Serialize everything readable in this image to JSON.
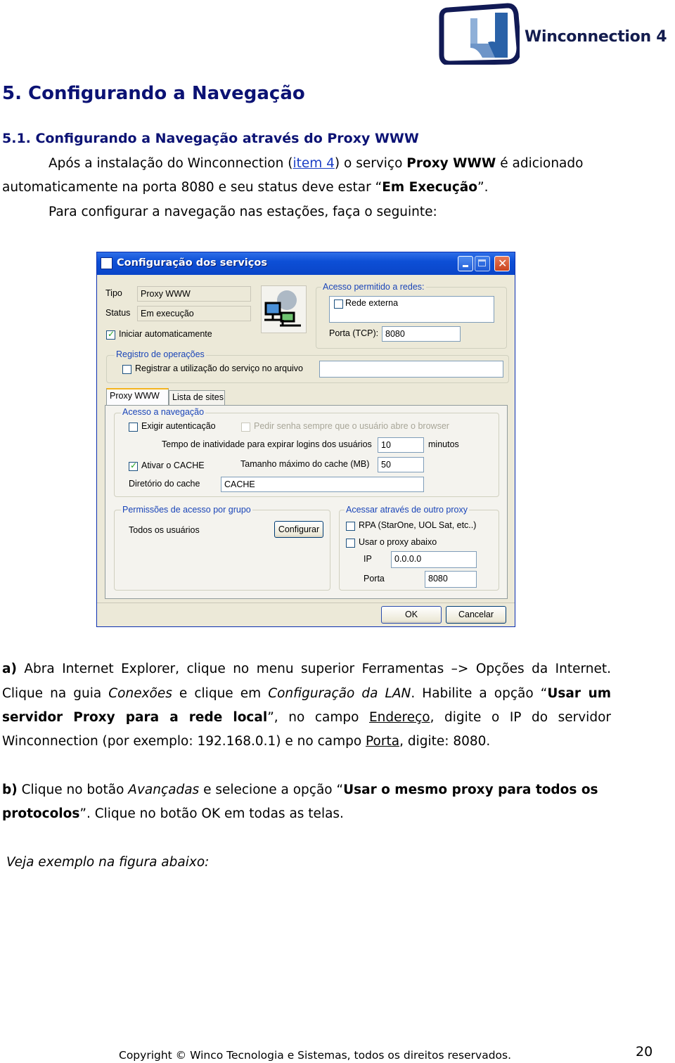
{
  "logo": {
    "text": "Winconnection 4",
    "icon": "winconnection-logo-icon"
  },
  "heading": "5. Configurando a Navegação",
  "subheading": "5.1. Configurando a Navegação através do Proxy WWW",
  "intro": {
    "line1_a": "Após a instalação do Winconnection (",
    "line1_link": "item 4",
    "line1_b": ") o serviço ",
    "line1_bold": "Proxy WWW",
    "line1_c": " é adicionado",
    "line2_a": "automaticamente na porta 8080 e seu status deve estar “",
    "line2_bold": "Em Execução",
    "line2_b": "”.",
    "line3": "Para configurar a navegação nas estações, faça o seguinte:"
  },
  "dialog": {
    "title": "Configuração dos serviços",
    "tipo_label": "Tipo",
    "tipo_value": "Proxy WWW",
    "status_label": "Status",
    "status_value": "Em execução",
    "auto_start_label": "Iniciar automaticamente",
    "auto_start_checked": true,
    "access_group_label": "Acesso permitido a redes:",
    "external_net_label": "Rede externa",
    "external_net_checked": false,
    "port_label": "Porta (TCP):",
    "port_value": "8080",
    "log_group_label": "Registro de operações",
    "log_checkbox_label": "Registrar a utilização do serviço no arquivo",
    "log_checked": false,
    "log_file_value": "",
    "tabs": [
      {
        "label": "Proxy WWW",
        "active": true
      },
      {
        "label": "Lista de sites",
        "active": false
      }
    ],
    "nav_group_label": "Acesso a navegação",
    "require_auth_label": "Exigir autenticação",
    "require_auth_checked": false,
    "ask_password_label": "Pedir senha sempre que o usuário abre o browser",
    "ask_password_checked": false,
    "idle_label": "Tempo de inatividade para expirar logins dos usuários",
    "idle_value": "10",
    "idle_unit": "minutos",
    "cache_enable_label": "Ativar o CACHE",
    "cache_enable_checked": true,
    "cache_size_label": "Tamanho máximo do cache (MB)",
    "cache_size_value": "50",
    "cache_dir_label": "Diretório do cache",
    "cache_dir_value": "CACHE",
    "perm_group_label": "Permissões de acesso por grupo",
    "perm_all_users": "Todos os usuários",
    "configure_button": "Configurar",
    "other_proxy_group_label": "Acessar através de outro proxy",
    "rpa_label": "RPA (StarOne, UOL Sat, etc..)",
    "rpa_checked": false,
    "use_proxy_label": "Usar o proxy abaixo",
    "use_proxy_checked": false,
    "ip_label": "IP",
    "ip_value": "0.0.0.0",
    "proxy_port_label": "Porta",
    "proxy_port_value": "8080",
    "ok_button": "OK",
    "cancel_button": "Cancelar"
  },
  "step_a": {
    "marker": "a)",
    "l1": " Abra Internet Explorer, clique no menu superior Ferramentas –> Opções da Internet.",
    "l2_a": "Clique na guia ",
    "l2_i1": "Conexões",
    "l2_b": " e clique em ",
    "l2_i2": "Configuração da LAN",
    "l2_c": ". Habilite a opção “",
    "l2_bold": "Usar um",
    "l3_bold": "servidor Proxy para a rede local",
    "l3_a": "”, no campo ",
    "l3_u": "Endereço",
    "l3_b": ", digite o IP do servidor",
    "l4_a": "Winconnection (por exemplo: 192.168.0.1) e no campo ",
    "l4_u": "Porta",
    "l4_b": ", digite: 8080."
  },
  "step_b": {
    "marker": "b)",
    "l1_a": " Clique no botão ",
    "l1_i": "Avançadas",
    "l1_b": " e selecione a opção “",
    "l1_bold": "Usar o mesmo proxy para todos os",
    "l2_bold": "protocolos",
    "l2_a": "”. Clique no botão OK em todas as telas."
  },
  "example_note": "Veja exemplo na figura abaixo:",
  "footer": {
    "copyright": "Copyright © Winco Tecnologia e Sistemas, todos os direitos reservados.",
    "page_number": "20"
  }
}
